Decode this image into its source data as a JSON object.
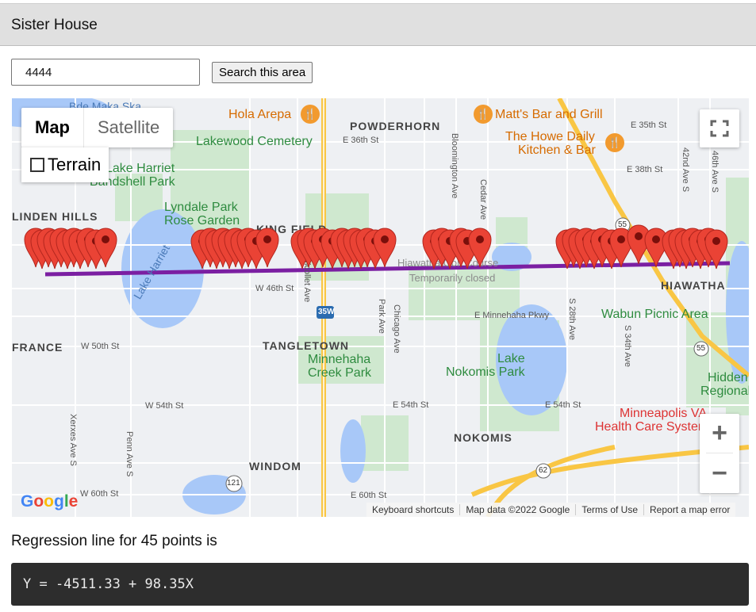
{
  "header": {
    "title": "Sister House"
  },
  "search": {
    "value": "4444",
    "button_label": "Search this area"
  },
  "map": {
    "type_control": {
      "map": "Map",
      "satellite": "Satellite",
      "terrain": "Terrain"
    },
    "labels": {
      "bde_maka_ska": "Bde Maka Ska",
      "hola_arepa": "Hola Arepa",
      "powderhorn": "POWDERHORN",
      "matts": "Matt's Bar and Grill",
      "e35": "E 35th St",
      "lakewood": "Lakewood Cemetery",
      "e36": "E 36th St",
      "howe1": "The Howe Daily",
      "howe2": "Kitchen & Bar",
      "harriet1": "Lake Harriet",
      "harriet2": "Bandshell Park",
      "e38": "E 38th St",
      "lyndale1": "Lyndale Park",
      "lyndale2": "Rose Garden",
      "linden_hills": "LINDEN HILLS",
      "king_field": "KING FIELD",
      "lake_harriet_water": "Lake Harriet",
      "w46": "W 46th St",
      "temp_closed": "Temporarily closed",
      "golf": "Hiawatha Golf Course",
      "hiawatha": "HIAWATHA",
      "i35w": "35W",
      "minnehaha_pkwy": "E Minnehaha Pkwy",
      "wabun": "Wabun Picnic Area",
      "w50": "W 50th St",
      "france": "FRANCE",
      "tangletown": "TANGLETOWN",
      "minnehaha1": "Minnehaha",
      "minnehaha2": "Creek Park",
      "nokomis1": "Lake",
      "nokomis2": "Nokomis Park",
      "hidden1": "Hidden",
      "hidden2": "Regional",
      "w54": "W 54th St",
      "e54a": "E 54th St",
      "e54b": "E 54th St",
      "va1": "Minneapolis VA",
      "va2": "Health Care System",
      "nokomis": "NOKOMIS",
      "windom": "WINDOM",
      "w60": "W 60th St",
      "e60": "E 60th St",
      "xerxes": "Xerxes Ave S",
      "penn": "Penn Ave S",
      "bloomington": "Bloomington Ave",
      "cedar": "Cedar Ave",
      "nicollet": "Nicollet Ave",
      "park": "Park Ave",
      "chicago": "Chicago Ave",
      "ave28": "S 28th Ave",
      "ave34": "S 34th Ave",
      "ave42": "42nd Ave S",
      "ave46": "46th Ave S",
      "rt55a": "55",
      "rt55b": "55",
      "rt62": "62",
      "rt121": "121"
    },
    "marker_count": 45,
    "attribution": {
      "shortcuts": "Keyboard shortcuts",
      "data": "Map data ©2022 Google",
      "terms": "Terms of Use",
      "report": "Report a map error"
    },
    "google_logo": "Google",
    "colors": {
      "regression_line": "#7b1fa2",
      "marker": "#ea4335",
      "water": "#a8c8f8",
      "park": "#c8e6c9",
      "highway": "#f9c644"
    }
  },
  "result": {
    "caption": "Regression line for 45 points is",
    "equation": "Y = -4511.33 + 98.35X"
  }
}
